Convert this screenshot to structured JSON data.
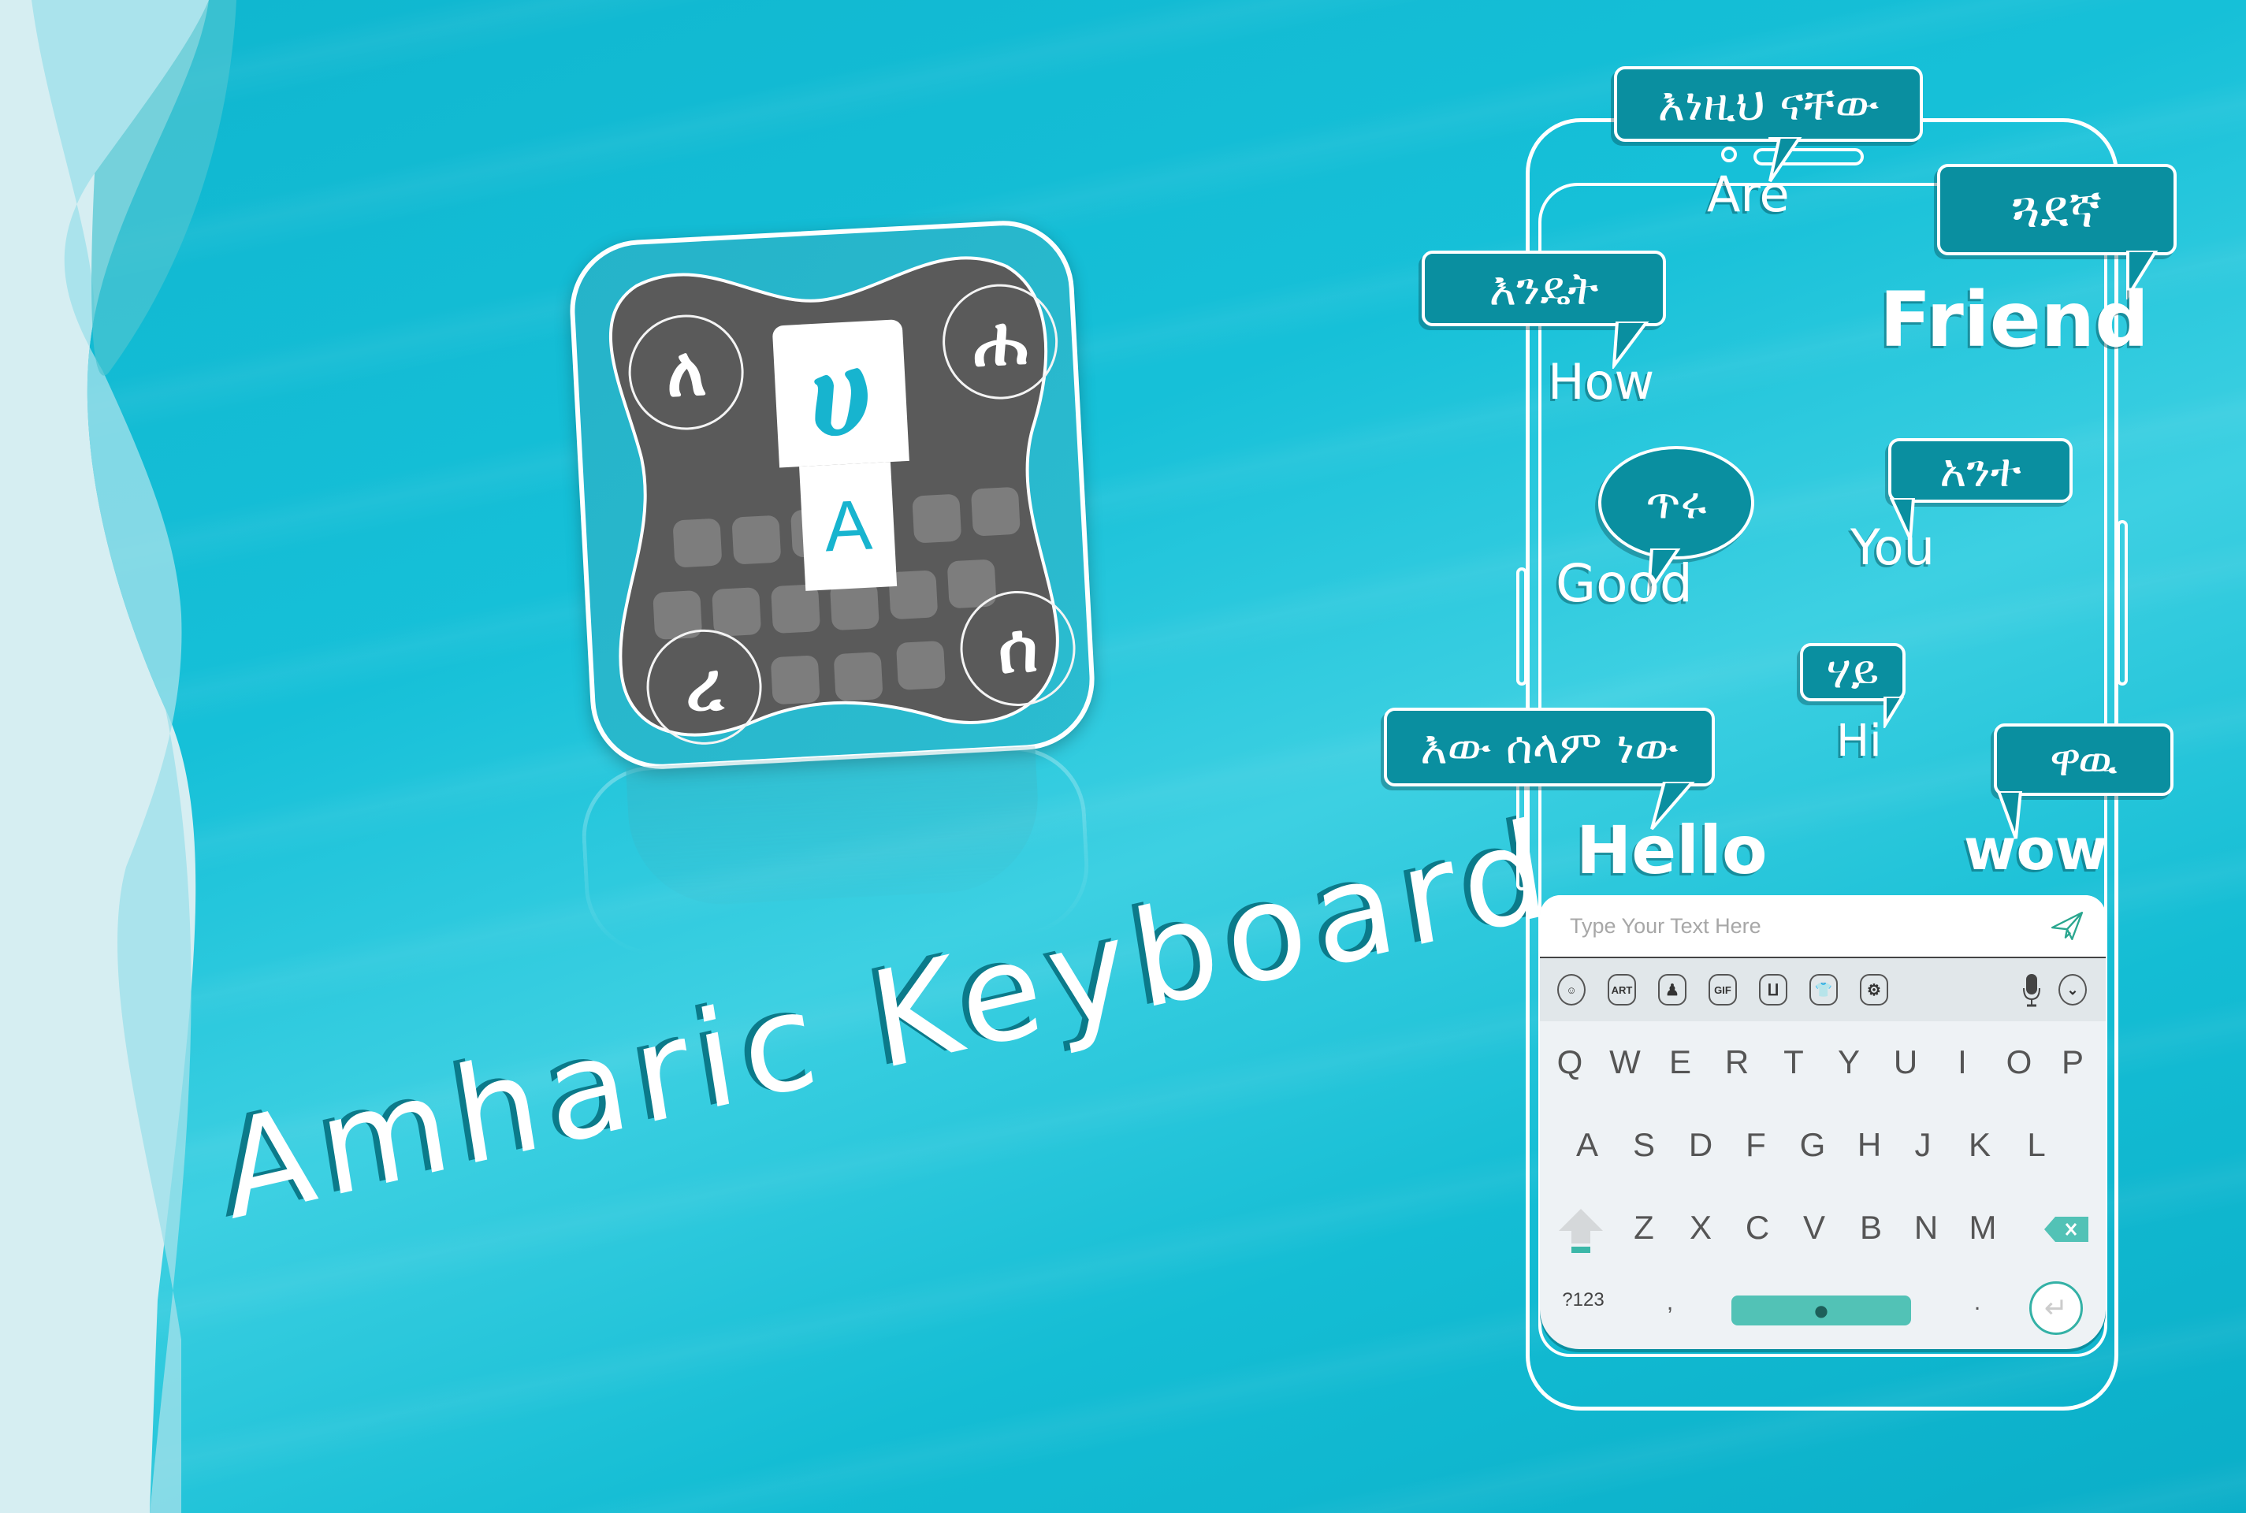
{
  "headline": "Amharic Keyboard",
  "colors": {
    "background": "#16c0d8",
    "bubble": "#0a8fa0",
    "accent": "#52c2b6",
    "icon_gray": "#5a5a5a",
    "icon_letter": "#17b4cf"
  },
  "app_icon": {
    "corner_glyphs": [
      "ለ",
      "ሐ",
      "ረ",
      "ሰ"
    ],
    "key_top_glyph": "ሀ",
    "key_bottom_glyph": "A"
  },
  "bubbles": [
    {
      "amharic": "እነዚህ ናቸው",
      "english": "Are"
    },
    {
      "amharic": "ጓደኛ",
      "english": "Friend"
    },
    {
      "amharic": "እንዴት",
      "english": "How"
    },
    {
      "amharic": "ጥሩ",
      "english": "Good"
    },
    {
      "amharic": "አንተ",
      "english": "You"
    },
    {
      "amharic": "ሃይ",
      "english": "Hi"
    },
    {
      "amharic": "እው ሰላም ነው",
      "english": "Hello"
    },
    {
      "amharic": "ዋዉ",
      "english": "wow"
    }
  ],
  "keyboard": {
    "input_placeholder": "Type Your Text Here",
    "toolbar": [
      {
        "icon": "emoji-icon",
        "label": ""
      },
      {
        "icon": "art-icon",
        "label": "ART"
      },
      {
        "icon": "sticker-icon",
        "label": ""
      },
      {
        "icon": "gif-icon",
        "label": "GIF"
      },
      {
        "icon": "kaomoji-icon",
        "label": ""
      },
      {
        "icon": "theme-icon",
        "label": ""
      },
      {
        "icon": "settings-icon",
        "label": ""
      },
      {
        "icon": "mic-icon",
        "label": ""
      },
      {
        "icon": "collapse-icon",
        "label": ""
      }
    ],
    "rows": [
      [
        "Q",
        "W",
        "E",
        "R",
        "T",
        "Y",
        "U",
        "I",
        "O",
        "P"
      ],
      [
        "A",
        "S",
        "D",
        "F",
        "G",
        "H",
        "J",
        "K",
        "L"
      ],
      [
        "Z",
        "X",
        "C",
        "V",
        "B",
        "N",
        "M"
      ]
    ],
    "symbols_key": "?123",
    "comma_key": ",",
    "period_key": "."
  }
}
